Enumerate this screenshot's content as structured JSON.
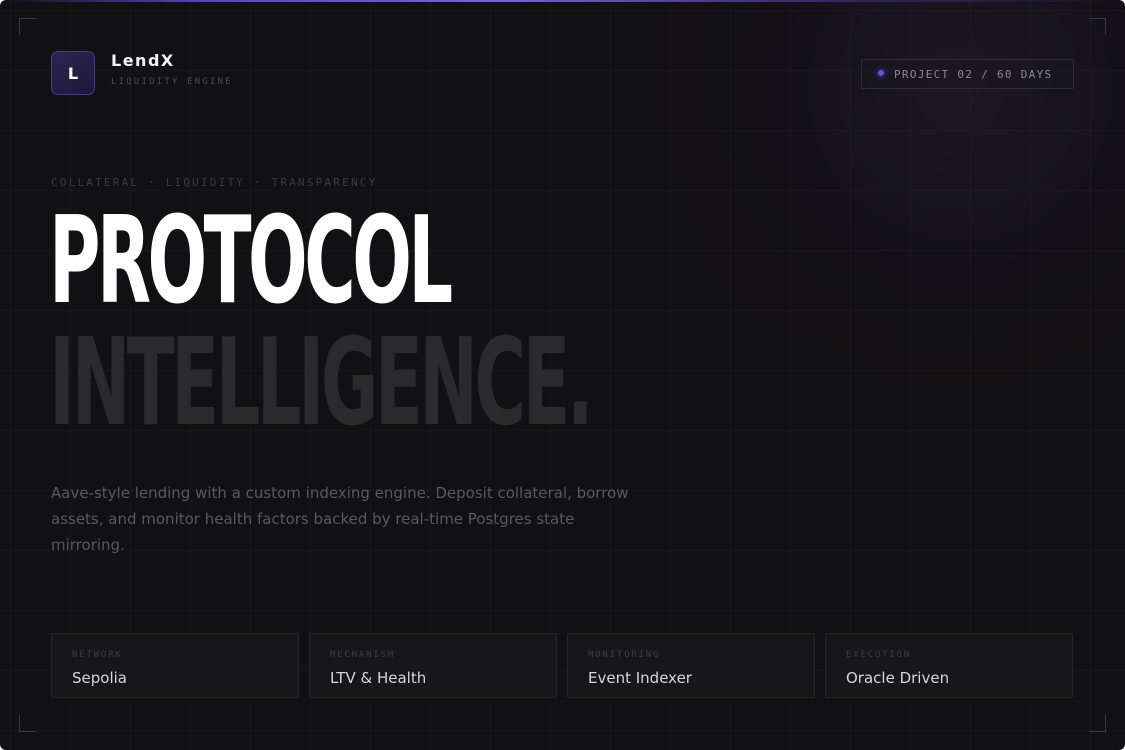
{
  "brand": {
    "logo_letter": "L",
    "name": "LendX",
    "subtitle": "LIQUIDITY ENGINE"
  },
  "project_badge": {
    "label": "PROJECT 02 / 60 DAYS",
    "dot_color": "#6a4cf0"
  },
  "hero": {
    "eyebrow": "COLLATERAL · LIQUIDITY · TRANSPARENCY",
    "headline_line1": "PROTOCOL",
    "headline_line2": "INTELLIGENCE.",
    "description": "Aave-style lending with a custom indexing engine. Deposit collateral, borrow assets, and monitor health factors backed by real-time Postgres state mirroring."
  },
  "cards": [
    {
      "label": "NETWORK",
      "value": "Sepolia"
    },
    {
      "label": "MECHANISM",
      "value": "LTV & Health"
    },
    {
      "label": "MONITORING",
      "value": "Event Indexer"
    },
    {
      "label": "EXECUTION",
      "value": "Oracle Driven"
    }
  ],
  "colors": {
    "background": "#111012",
    "accent": "#6a4cf0",
    "headline_primary": "#ffffff",
    "headline_secondary": "#2a292d"
  }
}
